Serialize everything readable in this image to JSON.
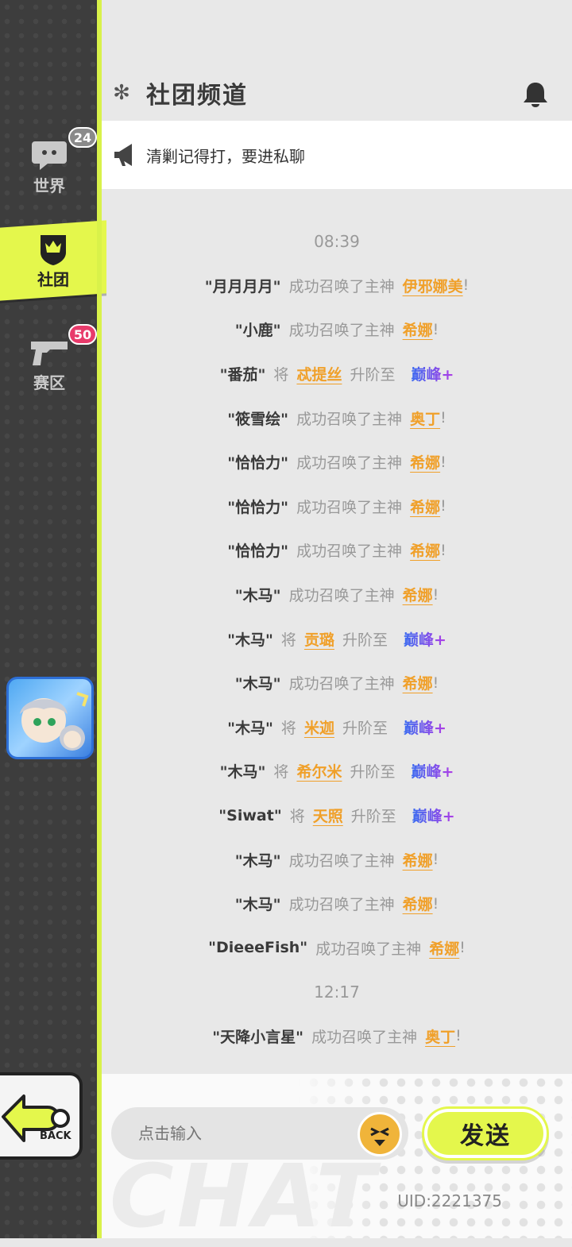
{
  "sidebar": {
    "tabs": [
      {
        "label": "世界",
        "badge": "24"
      },
      {
        "label": "社团",
        "badge": ""
      },
      {
        "label": "赛区",
        "badge": "50"
      }
    ],
    "back_label": "BACK"
  },
  "header": {
    "title": "社团频道"
  },
  "notice": {
    "text": "清剿记得打，要进私聊"
  },
  "messages": [
    {
      "type": "time",
      "text": "08:39"
    },
    {
      "type": "summon",
      "name": "\"月月月月\"",
      "action": "成功召唤了主神",
      "god": "伊邪娜美",
      "end": "!"
    },
    {
      "type": "summon",
      "name": "\"小鹿\"",
      "action": "成功召唤了主神",
      "god": "希娜",
      "end": "!"
    },
    {
      "type": "upgrade",
      "name": "\"番茄\"",
      "action": "将",
      "god": "忒提丝",
      "action2": "升阶至",
      "level": "巅峰+"
    },
    {
      "type": "summon",
      "name": "\"筱雪绘\"",
      "action": "成功召唤了主神",
      "god": "奥丁",
      "end": "!"
    },
    {
      "type": "summon",
      "name": "\"恰恰力\"",
      "action": "成功召唤了主神",
      "god": "希娜",
      "end": "!"
    },
    {
      "type": "summon",
      "name": "\"恰恰力\"",
      "action": "成功召唤了主神",
      "god": "希娜",
      "end": "!"
    },
    {
      "type": "summon",
      "name": "\"恰恰力\"",
      "action": "成功召唤了主神",
      "god": "希娜",
      "end": "!"
    },
    {
      "type": "summon",
      "name": "\"木马\"",
      "action": "成功召唤了主神",
      "god": "希娜",
      "end": "!"
    },
    {
      "type": "upgrade",
      "name": "\"木马\"",
      "action": "将",
      "god": "贡璐",
      "action2": "升阶至",
      "level": "巅峰+"
    },
    {
      "type": "summon",
      "name": "\"木马\"",
      "action": "成功召唤了主神",
      "god": "希娜",
      "end": "!"
    },
    {
      "type": "upgrade",
      "name": "\"木马\"",
      "action": "将",
      "god": "米迦",
      "action2": "升阶至",
      "level": "巅峰+"
    },
    {
      "type": "upgrade",
      "name": "\"木马\"",
      "action": "将",
      "god": "希尔米",
      "action2": "升阶至",
      "level": "巅峰+"
    },
    {
      "type": "upgrade",
      "name": "\"Siwat\"",
      "action": "将",
      "god": "天照",
      "action2": "升阶至",
      "level": "巅峰+"
    },
    {
      "type": "summon",
      "name": "\"木马\"",
      "action": "成功召唤了主神",
      "god": "希娜",
      "end": "!"
    },
    {
      "type": "summon",
      "name": "\"木马\"",
      "action": "成功召唤了主神",
      "god": "希娜",
      "end": "!"
    },
    {
      "type": "summon",
      "name": "\"DieeeFish\"",
      "action": "成功召唤了主神",
      "god": "希娜",
      "end": "!"
    },
    {
      "type": "time",
      "text": "12:17"
    },
    {
      "type": "summon",
      "name": "\"天降小言星\"",
      "action": "成功召唤了主神",
      "god": "奥丁",
      "end": "!"
    }
  ],
  "input": {
    "placeholder": "点击输入"
  },
  "send_label": "发送",
  "uid": "UID:2221375",
  "watermark": "CHAT",
  "colors": {
    "accent": "#e4f74c",
    "god": "#f0a02a",
    "sidebar": "#3d3d3d"
  }
}
